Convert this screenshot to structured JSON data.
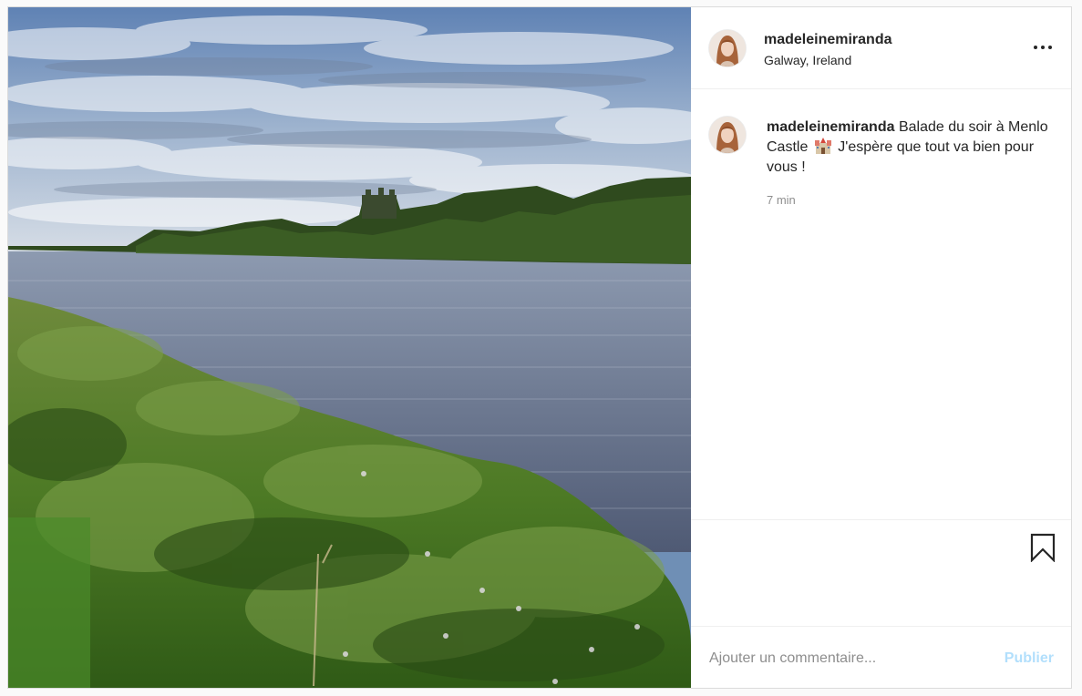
{
  "post": {
    "username": "madeleinemiranda",
    "location": "Galway, Ireland",
    "caption": {
      "username": "madeleinemiranda",
      "text_before_emoji": "Balade du soir à Menlo Castle",
      "emoji": "castle-emoji",
      "text_after_emoji": "J'espère que tout va bien pour vous !"
    },
    "time": "7 min"
  },
  "comment": {
    "placeholder": "Ajouter un commentaire...",
    "publish_label": "Publier"
  },
  "colors": {
    "publish_disabled": "#b2dffc",
    "secondary_text": "#8e8e8e",
    "primary_text": "#262626"
  },
  "icons": {
    "more": "more-options-icon",
    "bookmark": "bookmark-icon"
  }
}
